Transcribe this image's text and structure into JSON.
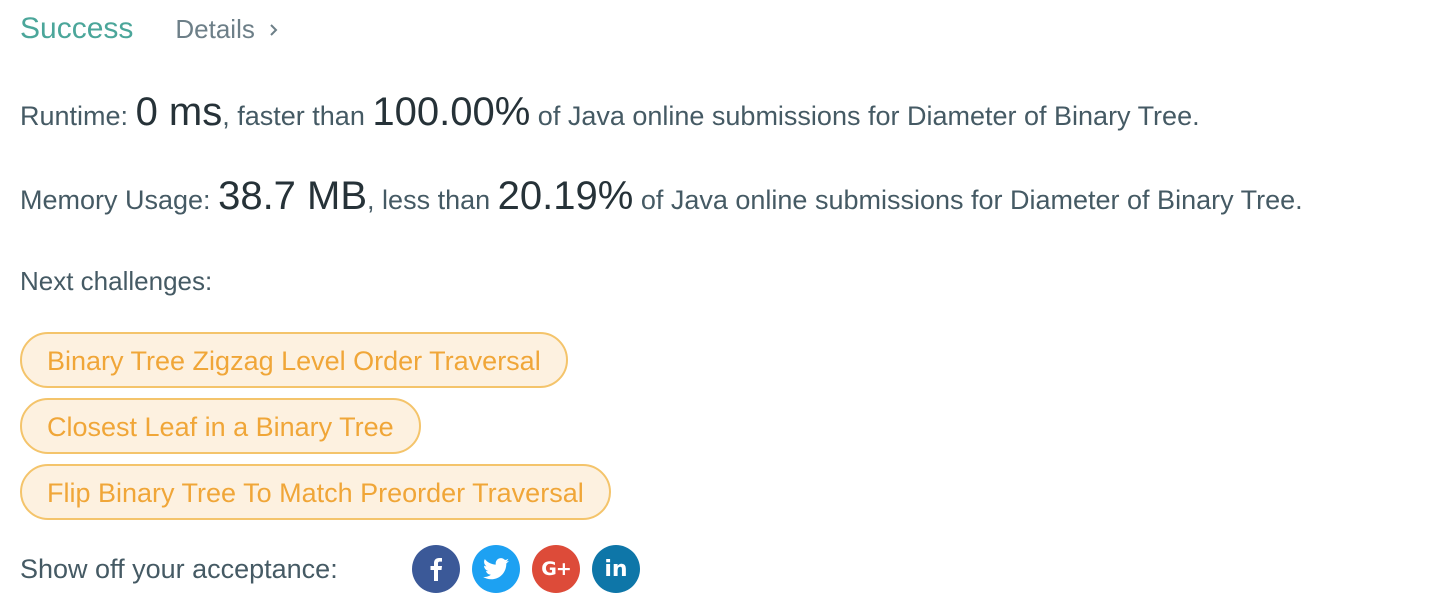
{
  "header": {
    "status": "Success",
    "details_label": "Details"
  },
  "runtime": {
    "label": "Runtime:",
    "value": "0 ms",
    "comparison": ", faster than",
    "percent": "100.00%",
    "suffix": "of Java online submissions for Diameter of Binary Tree."
  },
  "memory": {
    "label": "Memory Usage:",
    "value": "38.7 MB",
    "comparison": ", less than",
    "percent": "20.19%",
    "suffix": "of Java online submissions for Diameter of Binary Tree."
  },
  "next": {
    "label": "Next challenges:",
    "items": [
      {
        "label": "Binary Tree Zigzag Level Order Traversal"
      },
      {
        "label": "Closest Leaf in a Binary Tree"
      },
      {
        "label": "Flip Binary Tree To Match Preorder Traversal"
      }
    ]
  },
  "share": {
    "label": "Show off your acceptance:",
    "buttons": [
      {
        "icon": "facebook-icon",
        "color": "#3b5998"
      },
      {
        "icon": "twitter-icon",
        "color": "#1da1f2"
      },
      {
        "icon": "google-plus-icon",
        "color": "#dd4b39",
        "text": "G+"
      },
      {
        "icon": "linkedin-icon",
        "color": "#0e76a8",
        "text": "in"
      }
    ]
  },
  "colors": {
    "success": "#4ba69a",
    "pill_border": "#f4c46b",
    "pill_bg": "#fdf1e0",
    "pill_text": "#f0a638"
  }
}
